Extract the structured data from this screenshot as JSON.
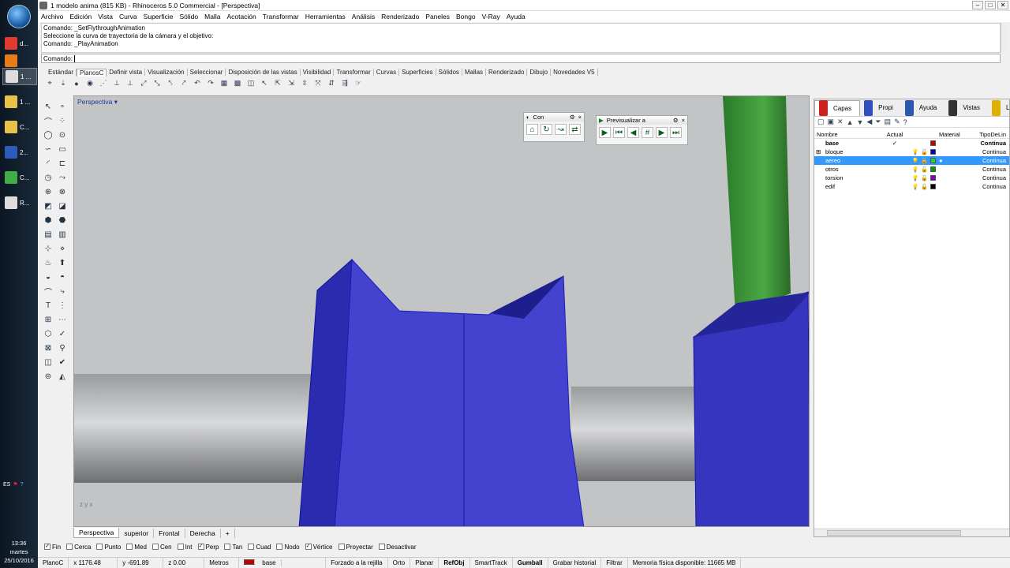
{
  "os": {
    "taskbar_items": [
      {
        "label": "d...",
        "color": "#e23a2e"
      },
      {
        "label": "",
        "color": "#e87a1a"
      },
      {
        "label": "1 ...",
        "color": "#ddd"
      },
      {
        "label": "1 ...",
        "color": "#e6c24a"
      },
      {
        "label": "C...",
        "color": "#e6c24a"
      },
      {
        "label": "2...",
        "color": "#2b5cb8"
      },
      {
        "label": "C...",
        "color": "#3fae49"
      },
      {
        "label": "R...",
        "color": "#ddd"
      }
    ],
    "tray_lang": "ES",
    "clock_time": "13:36",
    "clock_day": "martes",
    "clock_date": "25/10/2016"
  },
  "window": {
    "title": "1 modelo anima (815 KB) - Rhinoceros 5.0 Commercial - [Perspectiva]",
    "minimize": "–",
    "maximize": "□",
    "close": "✕"
  },
  "menu": [
    "Archivo",
    "Edición",
    "Vista",
    "Curva",
    "Superficie",
    "Sólido",
    "Malla",
    "Acotación",
    "Transformar",
    "Herramientas",
    "Análisis",
    "Renderizado",
    "Paneles",
    "Bongo",
    "V-Ray",
    "Ayuda"
  ],
  "command_history": [
    "Comando: _SetFlythroughAnimation",
    "Seleccione la curva de trayectoria de la cámara y el objetivo:",
    "Comando: _PlayAnimation"
  ],
  "command_prompt": "Comando:",
  "toolbar_tabs": [
    "Estándar",
    "PlanosC",
    "Definir vista",
    "Visualización",
    "Seleccionar",
    "Disposición de las vistas",
    "Visibilidad",
    "Transformar",
    "Curvas",
    "Superficies",
    "Sólidos",
    "Mallas",
    "Renderizado",
    "Dibujo",
    "Novedades V5"
  ],
  "active_toolbar_tab": "PlanosC",
  "viewport": {
    "label": "Perspectiva",
    "float1_title": "Con",
    "float2_title": "Previsualizar a",
    "axis_label": "z y x",
    "colors": {
      "bg": "#c3c4c6",
      "blue": "#3838c8",
      "green": "#3f9a3a",
      "gray": "#bfc0c2"
    }
  },
  "viewport_tabs": [
    "Perspectiva",
    "superior",
    "Frontal",
    "Derecha",
    "+"
  ],
  "active_viewport_tab": "Perspectiva",
  "panel": {
    "tabs": [
      "Capas",
      "Propi",
      "Ayuda",
      "Vistas",
      "Luces"
    ],
    "active_tab": "Capas",
    "columns": {
      "name": "Nombre",
      "current": "Actual",
      "material": "Material",
      "linetype": "TipoDeLin"
    },
    "layers": [
      {
        "name": "base",
        "current": "✓",
        "color": "#c00000",
        "linetype": "Continua",
        "bold": true,
        "selected": false,
        "expand": ""
      },
      {
        "name": "bloque",
        "current": "",
        "color": "#0000c0",
        "linetype": "Continua",
        "bold": false,
        "selected": false,
        "expand": "⊞"
      },
      {
        "name": "aereo",
        "current": "",
        "color": "#2ad62a",
        "linetype": "Continua",
        "bold": false,
        "selected": true,
        "expand": ""
      },
      {
        "name": "otros",
        "current": "",
        "color": "#00a000",
        "linetype": "Continua",
        "bold": false,
        "selected": false,
        "expand": ""
      },
      {
        "name": "torsion",
        "current": "",
        "color": "#8000c0",
        "linetype": "Continua",
        "bold": false,
        "selected": false,
        "expand": ""
      },
      {
        "name": "edif",
        "current": "",
        "color": "#000000",
        "linetype": "Continua",
        "bold": false,
        "selected": false,
        "expand": ""
      }
    ]
  },
  "osnaps": [
    {
      "label": "Fin",
      "checked": true
    },
    {
      "label": "Cerca",
      "checked": false
    },
    {
      "label": "Punto",
      "checked": false
    },
    {
      "label": "Med",
      "checked": false
    },
    {
      "label": "Cen",
      "checked": false
    },
    {
      "label": "Int",
      "checked": false
    },
    {
      "label": "Perp",
      "checked": true
    },
    {
      "label": "Tan",
      "checked": false
    },
    {
      "label": "Cuad",
      "checked": false
    },
    {
      "label": "Nodo",
      "checked": false
    },
    {
      "label": "Vértice",
      "checked": true
    },
    {
      "label": "Proyectar",
      "checked": false
    },
    {
      "label": "Desactivar",
      "checked": false
    }
  ],
  "status": {
    "cplane": "PlanoC",
    "x": "x 1176.48",
    "y": "y -691.89",
    "z": "z 0.00",
    "units": "Metros",
    "layer": "base",
    "layer_color": "#c00000",
    "toggles": [
      "Forzado a la rejilla",
      "Orto",
      "Planar",
      "RefObj",
      "SmartTrack",
      "Gumball",
      "Grabar historial",
      "Filtrar"
    ],
    "bold_toggles": [
      "RefObj",
      "Gumball"
    ],
    "memory": "Memoria física disponible: 11665 MB"
  }
}
